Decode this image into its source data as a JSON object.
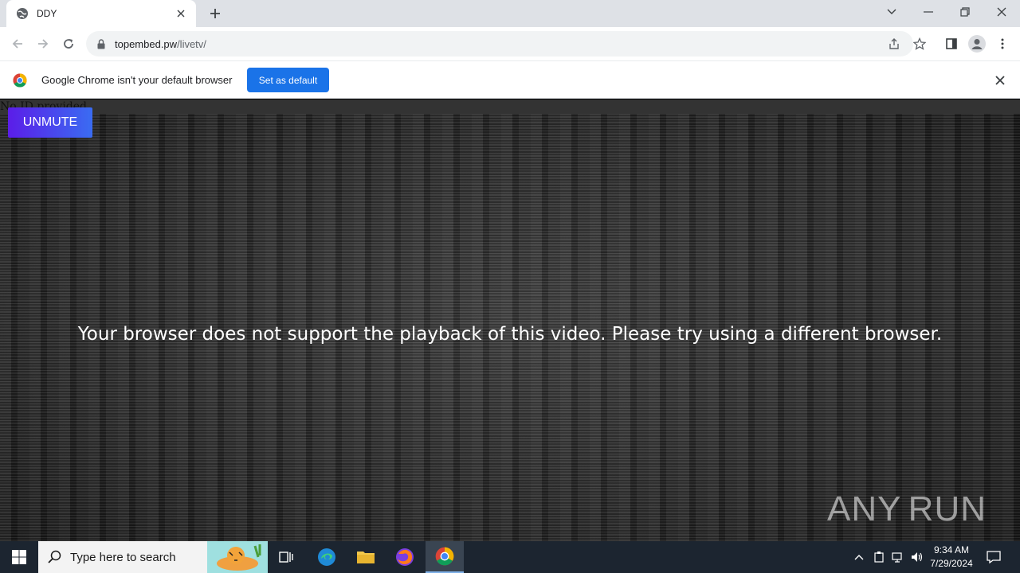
{
  "browser": {
    "tab_title": "DDY",
    "url_host": "topembed.pw",
    "url_path": "/livetv/"
  },
  "infobar": {
    "message": "Google Chrome isn't your default browser",
    "set_default_label": "Set as default"
  },
  "page": {
    "no_id_text": "No ID provided",
    "unmute_label": "UNMUTE",
    "error_message": "Your browser does not support the playback of this video. Please try using a different browser.",
    "watermark": "ANY RUN"
  },
  "taskbar": {
    "search_placeholder": "Type here to search",
    "time": "9:34 AM",
    "date": "7/29/2024"
  }
}
